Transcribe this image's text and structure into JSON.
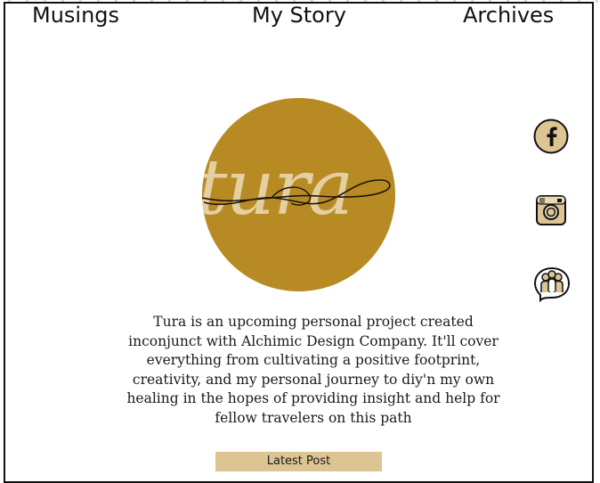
{
  "nav": {
    "musings": "Musings",
    "my_story": "My Story",
    "archives": "Archives"
  },
  "logo": {
    "text": "tura",
    "background_color": "#b78a23",
    "text_color": "#e3cf9f"
  },
  "social": {
    "facebook_icon": "facebook-icon",
    "instagram_icon": "instagram-icon",
    "community_icon": "community-icon",
    "icon_fill": "#dcc593"
  },
  "description": "Tura is an upcoming personal project created inconjunct with Alchimic Design Company. It'll cover everything from cultivating a positive footprint, creativity, and my personal journey to diy'n my own healing in the hopes of providing insight and help for fellow travelers on this path",
  "latest_post_button": "Latest Post"
}
